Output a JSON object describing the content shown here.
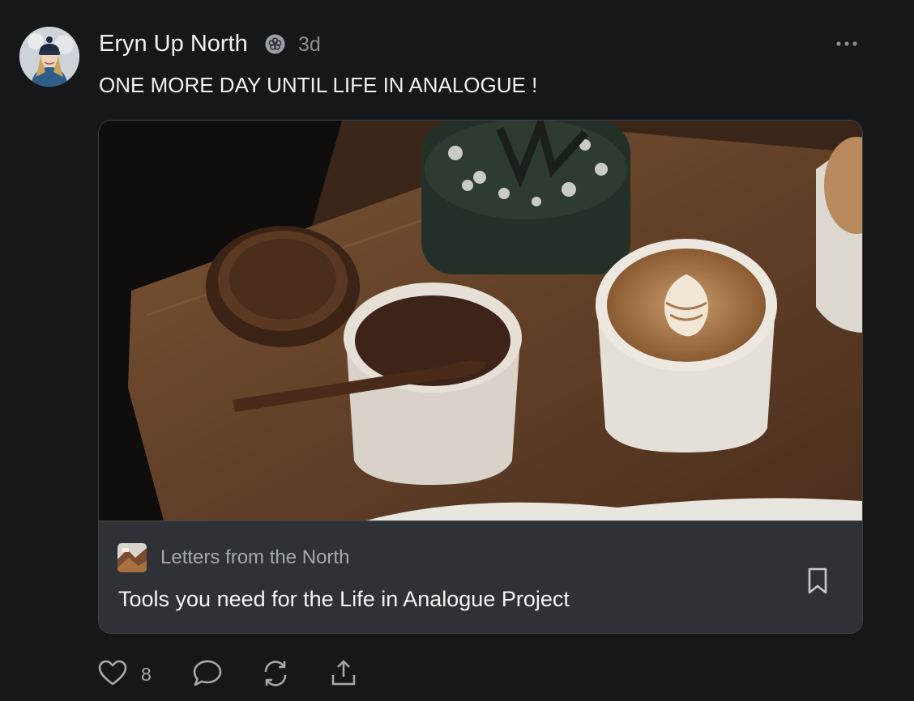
{
  "post": {
    "author": "Eryn Up North",
    "time": "3d",
    "text": "ONE MORE DAY UNTIL LIFE IN ANALOGUE !",
    "author_badge_icon": "flower-badge-icon",
    "more_icon": "more-horizontal-icon"
  },
  "card": {
    "publication": "Letters from the North",
    "title": "Tools you need for the Life in Analogue Project",
    "bookmark_icon": "bookmark-icon",
    "image_description_icon": "coffee-photo"
  },
  "actions": {
    "like_count": "8",
    "icons": [
      "heart-icon",
      "comment-icon",
      "restack-icon",
      "share-icon"
    ]
  },
  "colors": {
    "background": "#161719",
    "card_footer": "#2e3236",
    "text_primary": "#f1f2f3",
    "text_secondary": "#8a8f95"
  }
}
